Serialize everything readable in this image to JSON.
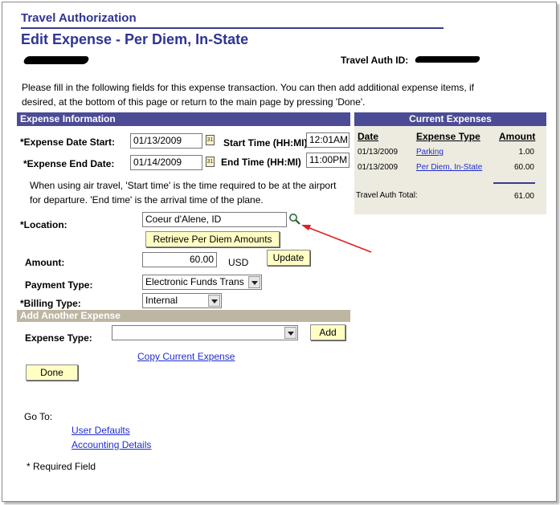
{
  "header": {
    "title": "Travel Authorization",
    "subtitle": "Edit Expense - Per Diem, In-State",
    "auth_id_label": "Travel Auth ID:"
  },
  "instructions": "Please fill in the following fields for this expense transaction. You can then add additional expense items, if desired, at the bottom of this page or return to the main page by pressing 'Done'.",
  "expense_info": {
    "heading": "Expense Information",
    "date_start_label": "*Expense Date Start:",
    "date_start_value": "01/13/2009",
    "start_time_label": "Start Time (HH:MI)",
    "start_time_value": "12:01AM",
    "date_end_label": "*Expense End Date:",
    "date_end_value": "01/14/2009",
    "end_time_label": "End Time (HH:MI)",
    "end_time_value": "11:00PM",
    "calendar_glyph": "31",
    "air_travel_note_1": "When using air travel, 'Start time' is the time required to be at the airport",
    "air_travel_note_2": "for departure.  'End time' is the arrival time of the plane.",
    "location_label": "*Location:",
    "location_value": "Coeur d'Alene, ID",
    "retrieve_button": "Retrieve Per Diem Amounts",
    "amount_label": "Amount:",
    "amount_value": "60.00",
    "currency": "USD",
    "update_button": "Update",
    "payment_type_label": "Payment Type:",
    "payment_type_value": "Electronic Funds Trans",
    "billing_type_label": "*Billing Type:",
    "billing_type_value": "Internal"
  },
  "add_expense": {
    "heading": "Add Another Expense",
    "expense_type_label": "Expense Type:",
    "expense_type_value": "",
    "add_button": "Add",
    "copy_link": "Copy Current Expense"
  },
  "done_button": "Done",
  "goto": {
    "label": "Go To:",
    "links": [
      "User Defaults",
      "Accounting Details"
    ]
  },
  "required_note": "* Required Field",
  "current_expenses": {
    "heading": "Current Expenses",
    "columns": [
      "Date",
      "Expense Type",
      "Amount"
    ],
    "rows": [
      {
        "date": "01/13/2009",
        "type": "Parking",
        "amount": "1.00"
      },
      {
        "date": "01/13/2009",
        "type": "Per Diem, In-State",
        "amount": "60.00"
      }
    ],
    "total_label": "Travel Auth Total:",
    "total_value": "61.00"
  },
  "colors": {
    "section_header": "#4b4b96",
    "title_text": "#2f3591",
    "button_bg": "#ffffc4",
    "panel_bg": "#edebe0",
    "tan_header": "#bdb6a2",
    "link": "#1f2ccf",
    "annotation_arrow": "#e02020"
  },
  "icons": {
    "calendar": "calendar-icon",
    "lookup": "magnifier-icon",
    "dropdown": "chevron-down-icon"
  }
}
